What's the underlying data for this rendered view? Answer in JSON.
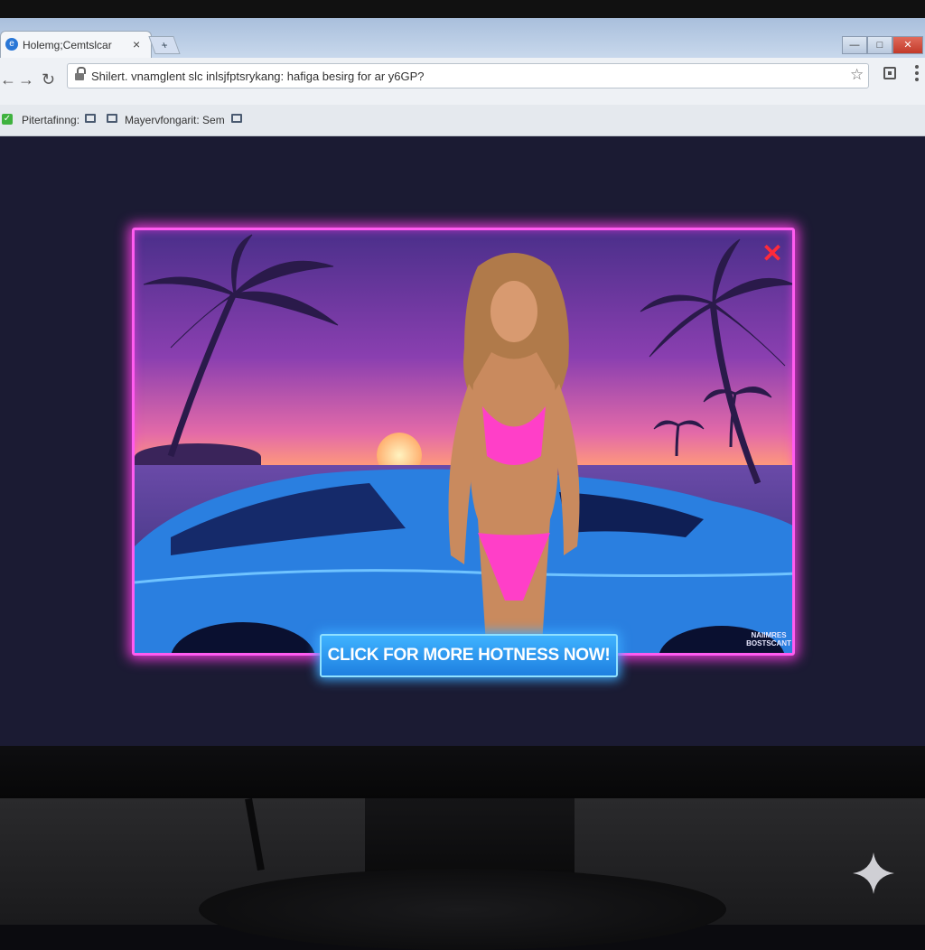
{
  "browser": {
    "tab": {
      "title": "Holemg;Cemtslcar",
      "close": "×",
      "new_tab": "+"
    },
    "window_buttons": {
      "minimize": "—",
      "maximize": "□",
      "close": "✕"
    },
    "nav": {
      "back": "←",
      "forward": "→",
      "reload": "↻"
    },
    "omnibox": {
      "url": "Shilert. vnamglent slc  inlsjfptsrykang: hafiga besirg for ar y6GP?"
    },
    "bookmarks": [
      {
        "label": "Pitertafinng:"
      },
      {
        "label": "Mayervfongarit: Sem"
      }
    ]
  },
  "ad": {
    "cta_label": "CLICK FOR MORE HOTNESS NOW!",
    "watermark": "NAIIMRES BOSTSCANT",
    "close_symbol": "✕"
  },
  "colors": {
    "neon_pink": "#ff5cf0",
    "neon_blue": "#3fb3ff",
    "close_red": "#ff2a3a"
  }
}
